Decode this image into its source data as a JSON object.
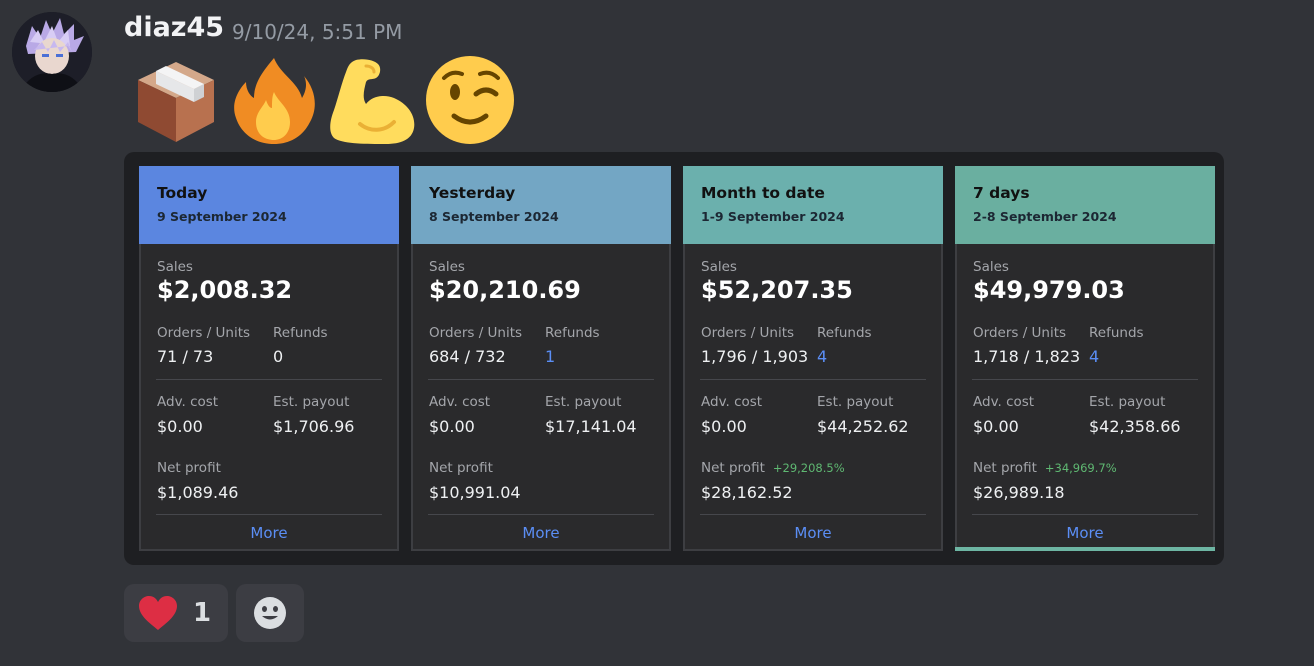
{
  "message": {
    "username": "diaz45",
    "timestamp": "9/10/24, 5:51 PM",
    "emojis": [
      "package-emoji",
      "fire-emoji",
      "flexed-biceps-emoji",
      "winking-face-emoji"
    ]
  },
  "cards": [
    {
      "title": "Today",
      "date": "9 September 2024",
      "header_color": "#5b86e0",
      "sales_label": "Sales",
      "sales": "$2,008.32",
      "orders_label": "Orders / Units",
      "orders": "71 / 73",
      "refunds_label": "Refunds",
      "refunds": "0",
      "adv_label": "Adv. cost",
      "adv": "$0.00",
      "payout_label": "Est. payout",
      "payout": "$1,706.96",
      "net_label": "Net profit",
      "net_change": "",
      "net": "$1,089.46",
      "more": "More"
    },
    {
      "title": "Yesterday",
      "date": "8 September 2024",
      "header_color": "#73a6c4",
      "sales_label": "Sales",
      "sales": "$20,210.69",
      "orders_label": "Orders / Units",
      "orders": "684 / 732",
      "refunds_label": "Refunds",
      "refunds": "1",
      "adv_label": "Adv. cost",
      "adv": "$0.00",
      "payout_label": "Est. payout",
      "payout": "$17,141.04",
      "net_label": "Net profit",
      "net_change": "",
      "net": "$10,991.04",
      "more": "More"
    },
    {
      "title": "Month to date",
      "date": "1-9 September 2024",
      "header_color": "#6bb0ad",
      "sales_label": "Sales",
      "sales": "$52,207.35",
      "orders_label": "Orders / Units",
      "orders": "1,796 / 1,903",
      "refunds_label": "Refunds",
      "refunds": "4",
      "adv_label": "Adv. cost",
      "adv": "$0.00",
      "payout_label": "Est. payout",
      "payout": "$44,252.62",
      "net_label": "Net profit",
      "net_change": "+29,208.5%",
      "net": "$28,162.52",
      "more": "More"
    },
    {
      "title": "7 days",
      "date": "2-8 September 2024",
      "header_color": "#6aafa0",
      "sales_label": "Sales",
      "sales": "$49,979.03",
      "orders_label": "Orders / Units",
      "orders": "1,718 / 1,823",
      "refunds_label": "Refunds",
      "refunds": "4",
      "adv_label": "Adv. cost",
      "adv": "$0.00",
      "payout_label": "Est. payout",
      "payout": "$42,358.66",
      "net_label": "Net profit",
      "net_change": "+34,969.7%",
      "net": "$26,989.18",
      "more": "More"
    }
  ],
  "reactions": {
    "heart_icon": "heart-icon",
    "heart_count": "1",
    "add_icon": "add-reaction-icon"
  },
  "colors": {
    "background": "#313338",
    "embed": "#1e1f22",
    "card": "#2a2a2c",
    "link": "#5b8ef5",
    "positive": "#5fb872"
  }
}
